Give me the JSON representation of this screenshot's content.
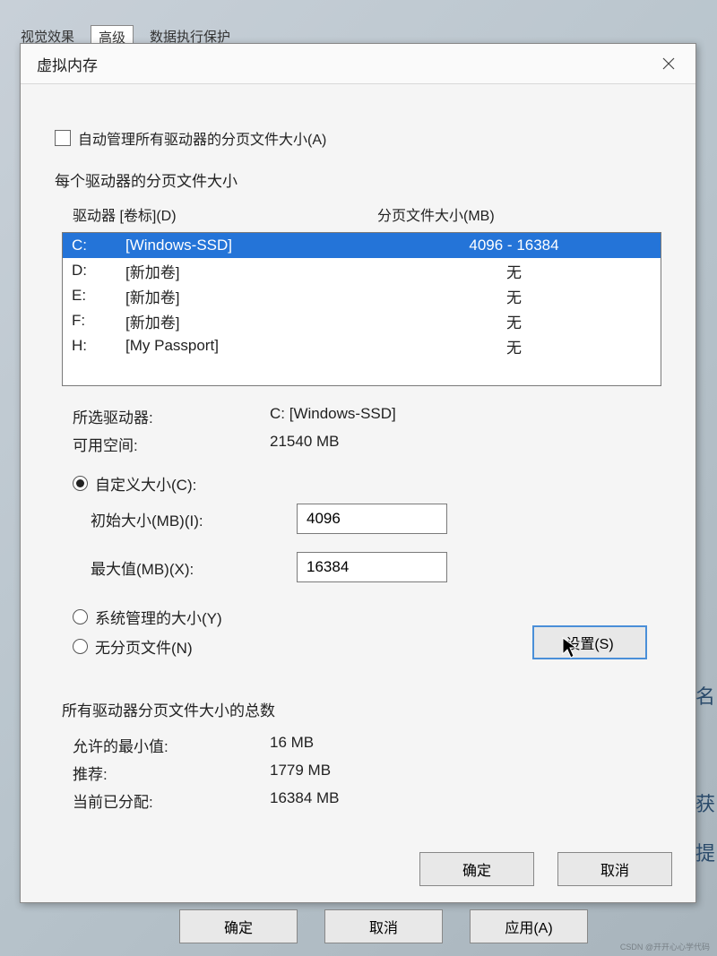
{
  "bg_tabs": {
    "visual": "视觉效果",
    "advanced": "高级",
    "dep": "数据执行保护"
  },
  "dialog": {
    "title": "虚拟内存",
    "auto_manage": "自动管理所有驱动器的分页文件大小(A)",
    "per_drive_label": "每个驱动器的分页文件大小",
    "drive_header_col1": "驱动器 [卷标](D)",
    "drive_header_col2": "分页文件大小(MB)",
    "drives": [
      {
        "letter": "C:",
        "label": "[Windows-SSD]",
        "size": "4096 - 16384",
        "selected": true
      },
      {
        "letter": "D:",
        "label": "[新加卷]",
        "size": "无",
        "selected": false
      },
      {
        "letter": "E:",
        "label": "[新加卷]",
        "size": "无",
        "selected": false
      },
      {
        "letter": "F:",
        "label": "[新加卷]",
        "size": "无",
        "selected": false
      },
      {
        "letter": "H:",
        "label": "[My Passport]",
        "size": "无",
        "selected": false
      }
    ],
    "selected_drive_label": "所选驱动器:",
    "selected_drive_value": "C:  [Windows-SSD]",
    "free_space_label": "可用空间:",
    "free_space_value": "21540 MB",
    "radio_custom": "自定义大小(C):",
    "initial_label": "初始大小(MB)(I):",
    "initial_value": "4096",
    "max_label": "最大值(MB)(X):",
    "max_value": "16384",
    "radio_system": "系统管理的大小(Y)",
    "radio_none": "无分页文件(N)",
    "set_button": "设置(S)",
    "totals_header": "所有驱动器分页文件大小的总数",
    "min_label": "允许的最小值:",
    "min_value": "16 MB",
    "rec_label": "推荐:",
    "rec_value": "1779 MB",
    "cur_label": "当前已分配:",
    "cur_value": "16384 MB",
    "ok": "确定",
    "cancel": "取消"
  },
  "parent_buttons": {
    "ok": "确定",
    "cancel": "取消",
    "apply": "应用(A)"
  },
  "side_text": {
    "t1": "获",
    "t2": "提",
    "t3": "名"
  },
  "watermark": "CSDN @开开心心学代码"
}
